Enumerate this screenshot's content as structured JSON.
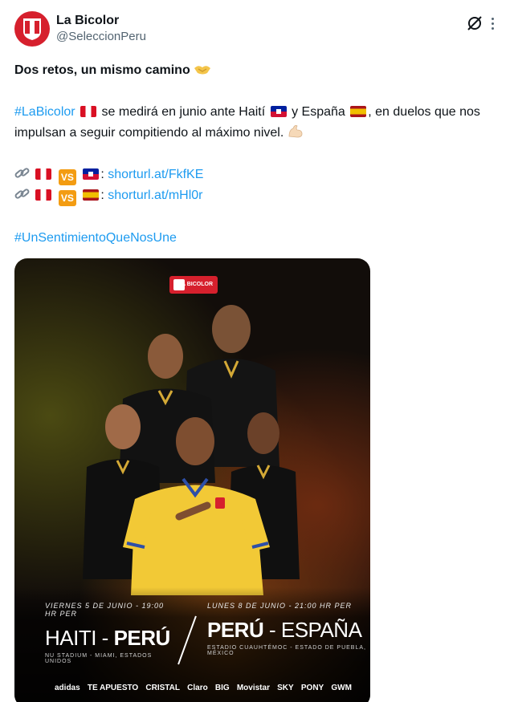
{
  "account": {
    "display_name": "La Bicolor",
    "handle": "@SeleccionPeru"
  },
  "tweet": {
    "headline": "Dos retos, un mismo camino",
    "headline_emoji": "handshake",
    "hashtag_labicolor": "#LaBicolor",
    "body_part1": "se medirá en junio ante Haití",
    "body_part2": "y España",
    "body_part3": ", en duelos que nos impulsan a seguir compitiendo al máximo nivel.",
    "body_emoji": "flexed-biceps",
    "vs_label": "VS",
    "links": [
      {
        "url": "shorturl.at/FkfKE",
        "opponent_flag": "haiti"
      },
      {
        "url": "shorturl.at/mHl0r",
        "opponent_flag": "spain"
      }
    ],
    "closing_hashtag": "#UnSentimientoQueNosUne"
  },
  "poster": {
    "logo_text": "LA BICOLOR",
    "match1": {
      "date": "VIERNES 5 DE JUNIO - 19:00 HR PER",
      "team_a": "HAITI",
      "separator": " - ",
      "team_b": "PERÚ",
      "venue": "NU STADIUM - MIAMI, ESTADOS UNIDOS"
    },
    "match2": {
      "date": "LUNES 8 DE JUNIO - 21:00 HR PER",
      "team_a": "PERÚ",
      "separator": " - ",
      "team_b": "ESPAÑA",
      "venue": "ESTADIO CUAUHTÉMOC - ESTADO DE PUEBLA, MÉXICO"
    },
    "sponsors": [
      "adidas",
      "TE APUESTO",
      "CRISTAL",
      "Claro",
      "BIG",
      "Movistar",
      "SKY",
      "PONY",
      "GWM"
    ]
  },
  "colors": {
    "link_blue": "#1d9bf0",
    "peru_red": "#d6202d",
    "vs_orange": "#f39c12"
  }
}
